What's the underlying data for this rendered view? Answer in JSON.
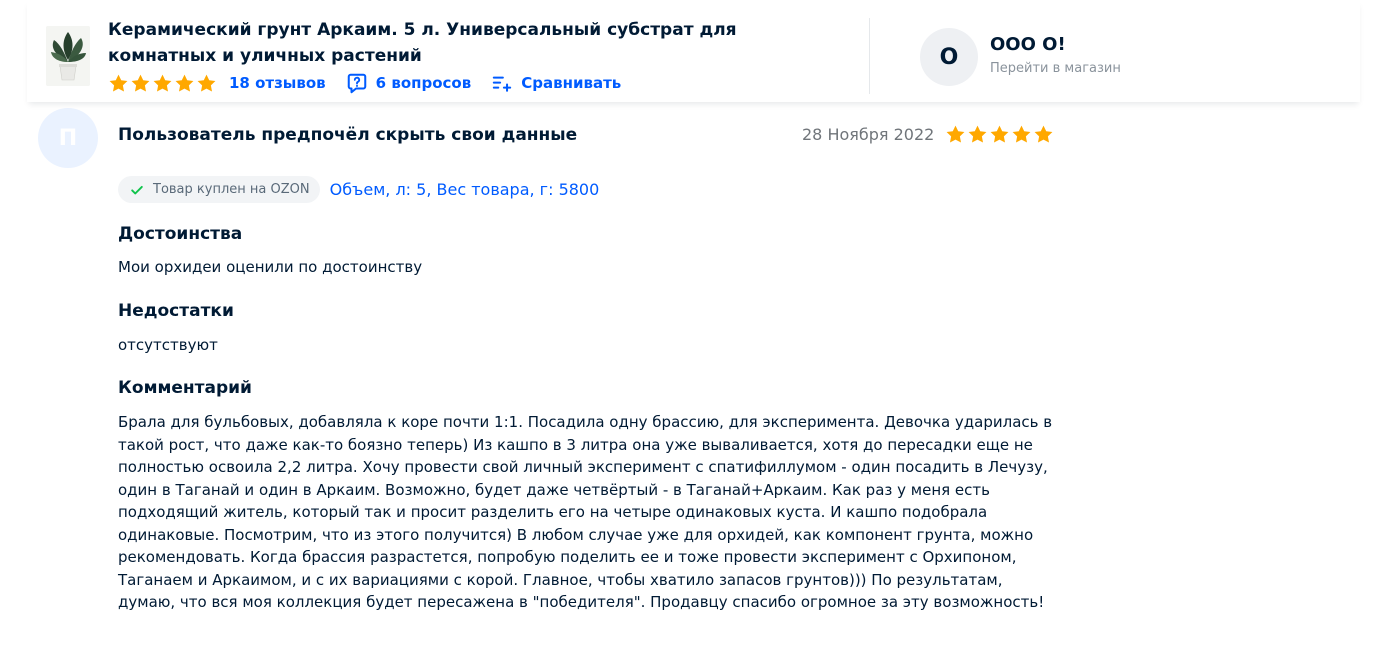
{
  "product": {
    "title": "Керамический грунт Аркаим. 5 л. Универсальный субстрат для комнатных и уличных растений",
    "rating_stars": 5,
    "reviews_link": "18 отзывов",
    "questions_link": "6 вопросов",
    "compare_link": "Сравнивать"
  },
  "shop": {
    "avatar_letter": "О",
    "name": "ООО О!",
    "link": "Перейти в магазин"
  },
  "review": {
    "avatar_letter": "П",
    "author": "Пользователь предпочёл скрыть свои данные",
    "date": "28 Ноября 2022",
    "rating_stars": 5,
    "purchase_badge": "Товар куплен на OZON",
    "variant": "Объем, л: 5, Вес товара, г: 5800",
    "sections": [
      {
        "title": "Достоинства",
        "text": "Мои орхидеи оценили по достоинству"
      },
      {
        "title": "Недостатки",
        "text": "отсутствуют"
      },
      {
        "title": "Комментарий",
        "text": "Брала для бульбовых, добавляла к коре почти 1:1. Посадила одну брассию, для эксперимента. Девочка ударилась в такой рост, что даже как-то боязно теперь) Из кашпо в 3 литра она уже вываливается, хотя до пересадки еще не полностью освоила 2,2 литра. Хочу провести свой личный эксперимент с спатифиллумом - один посадить в Лечузу, один в Таганай и один в Аркаим. Возможно, будет даже четвёртый - в Таганай+Аркаим. Как раз у меня есть подходящий житель, который так и просит разделить его на четыре одинаковых куста. И кашпо подобрала одинаковые. Посмотрим, что из этого получится) В любом случае уже для орхидей, как компонент грунта, можно рекомендовать. Когда брассия разрастется, попробую поделить ее и тоже провести эксперимент с Орхипоном, Таганаем и Аркаимом, и с их вариациями с корой. Главное, чтобы хватило запасов грунтов))) По результатам, думаю, что вся моя коллекция будет пересажена в \"победителя\". Продавцу спасибо огромное за эту возможность!"
      }
    ]
  },
  "colors": {
    "accent": "#005bff",
    "star": "#ffa800",
    "text": "#001a34",
    "muted": "#70757a",
    "check": "#10c44c"
  },
  "icons": {
    "star": "star-icon",
    "questions": "question-bubble-icon",
    "compare": "compare-list-icon",
    "check": "check-icon",
    "product": "plant-pot-image"
  }
}
